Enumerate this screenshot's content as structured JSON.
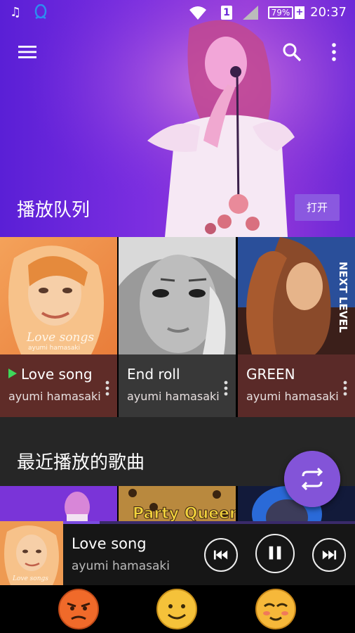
{
  "status_bar": {
    "battery": "79%",
    "sim_slot": "1",
    "time": "20:37",
    "icons": [
      "music-note-icon",
      "qq-icon",
      "wifi-icon",
      "signal-icon",
      "battery-icon",
      "charging-icon"
    ]
  },
  "hero": {
    "title": "播放队列",
    "open_button": "打开",
    "menu_icon": "menu-icon",
    "search_icon": "search-icon",
    "more_icon": "more-vert-icon"
  },
  "cards": [
    {
      "title": "Love song",
      "artist": "ayumi hamasaki",
      "playing": true,
      "art_caption": "Love songs",
      "art_sub": "ayumi hamasaki",
      "info_color": "#5f2c28"
    },
    {
      "title": "End roll",
      "artist": "ayumi hamasaki",
      "playing": false,
      "art_caption": "",
      "art_sub": "",
      "info_color": "#383838"
    },
    {
      "title": "GREEN",
      "artist": "ayumi hamasaki",
      "playing": false,
      "art_caption": "NEXT LEVEL",
      "art_sub": "",
      "info_color": "#5a2a28"
    }
  ],
  "recent": {
    "title": "最近播放的歌曲",
    "thumb_caption": "Party Queen"
  },
  "now_playing": {
    "title": "Love song",
    "artist": "ayumi hamasaki",
    "art_caption": "Love songs",
    "progress": 0.28
  },
  "colors": {
    "accent": "#8354d8",
    "playing_indicator": "#3ed85a"
  }
}
